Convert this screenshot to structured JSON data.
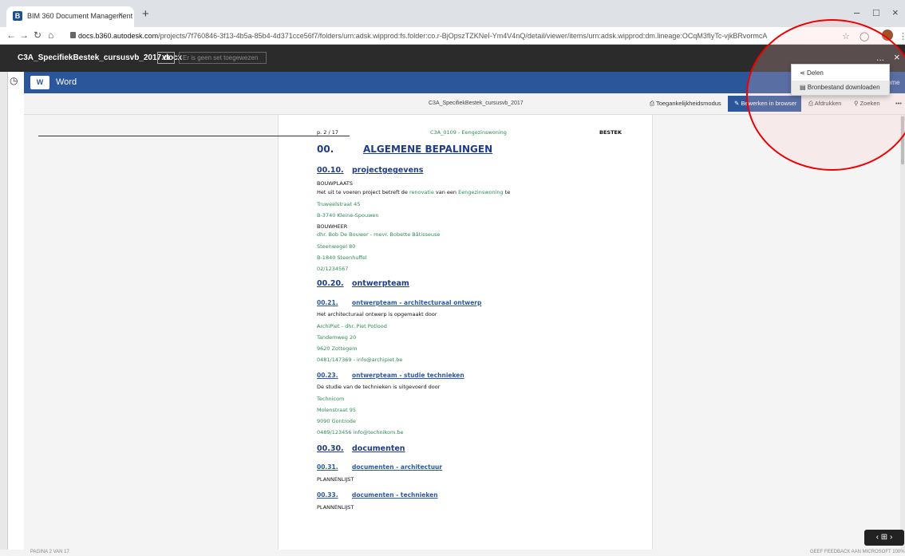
{
  "browser": {
    "tab_title": "BIM 360 Document Management",
    "tab_close": "×",
    "new_tab": "+",
    "url_host": "docs.b360.autodesk.com",
    "url_path": "/projects/7f760846-3f13-4b5a-85b4-4d371cce56f7/folders/urn:adsk.wipprod:fs.folder:co.r-BjOpszTZKNeI-Ym4V4nQ/detail/viewer/items/urn:adsk.wipprod:dm.lineage:OCqM3fIyTc-vjkBRvormcA",
    "win_min": "–",
    "win_max": "□",
    "win_close": "×"
  },
  "app": {
    "doc_name": "C3A_SpecifiekBestek_cursusvb_2017.docx",
    "version": "V1",
    "set_placeholder": "Er is geen set toegewezen",
    "more": "...",
    "close": "×"
  },
  "word": {
    "label": "Word",
    "logo": "W",
    "truncated_name": "nme"
  },
  "toolbar": {
    "title": "C3A_SpecifiekBestek_cursusvb_2017",
    "accessibility": "Toegankelijkheidsmodus",
    "edit": "Bewerken in browser",
    "print": "Afdrukken",
    "search": "Zoeken",
    "more": "•••"
  },
  "menu": {
    "share": "Delen",
    "download": "Bronbestand downloaden"
  },
  "page": {
    "header_left": "p. 2 / 17",
    "header_mid": "C3A_0109 - Eengezinswoning",
    "header_right": "BESTEK",
    "s00": "00.",
    "s00_title": "ALGEMENE BEPALINGEN",
    "s0010": "00.10.",
    "s0010_title": "projectgegevens",
    "bouwplaats": "BOUWPLAATS",
    "proj_pre": "Het uit te voeren project betreft de",
    "proj_reno": "renovatie",
    "proj_mid": "van een",
    "proj_type": "Eengezinswoning",
    "proj_post": "te",
    "addr1": "Truweelstraat 45",
    "addr2": "B-3740 Kleine-Spouwen",
    "bouwheer": "BOUWHEER",
    "owner": "dhr. Bob De Bouwer  -  mevr. Bobette Bâtisseuse",
    "owner_addr1": "Steenwegel 80",
    "owner_addr2": "B-1840 Steenhuffel",
    "owner_phone": "02/1234567",
    "s0020": "00.20.",
    "s0020_title": "ontwerpteam",
    "s0021": "00.21.",
    "s0021_title": "ontwerpteam - architecturaal ontwerp",
    "arch_intro": "Het architecturaal ontwerp is opgemaakt door",
    "arch_name": "ArchiPiet - dhr. Piet Potlood",
    "arch_addr1": "Tandemweg 20",
    "arch_addr2": "9620 Zottegem",
    "arch_contact": "0481/147369  -  info@archipiet.be",
    "s0023": "00.23.",
    "s0023_title": "ontwerpteam - studie technieken",
    "tech_intro": "De studie van de technieken is uitgevoerd door",
    "tech_name": "Technicom",
    "tech_addr1": "Molenstraat 95",
    "tech_addr2": "9090 Gontrode",
    "tech_contact": "0489/123456   info@technikom.be",
    "s0030": "00.30.",
    "s0030_title": "documenten",
    "s0031": "00.31.",
    "s0031_title": "documenten - architectuur",
    "plannen1": "PLANNENLIJST",
    "s0033": "00.33.",
    "s0033_title": "documenten - technieken",
    "plannen2": "PLANNENLIJST"
  },
  "status": {
    "left": "PAGINA 2 VAN 17",
    "right": "GEEF FEEDBACK AAN MICROSOFT    100%"
  },
  "pager": "‹  ⊞  ›",
  "colors": {
    "word_blue": "#2b579a",
    "heading_blue": "#1f3c88",
    "text_green": "#2e8b57",
    "annotation_red": "#e00000"
  }
}
